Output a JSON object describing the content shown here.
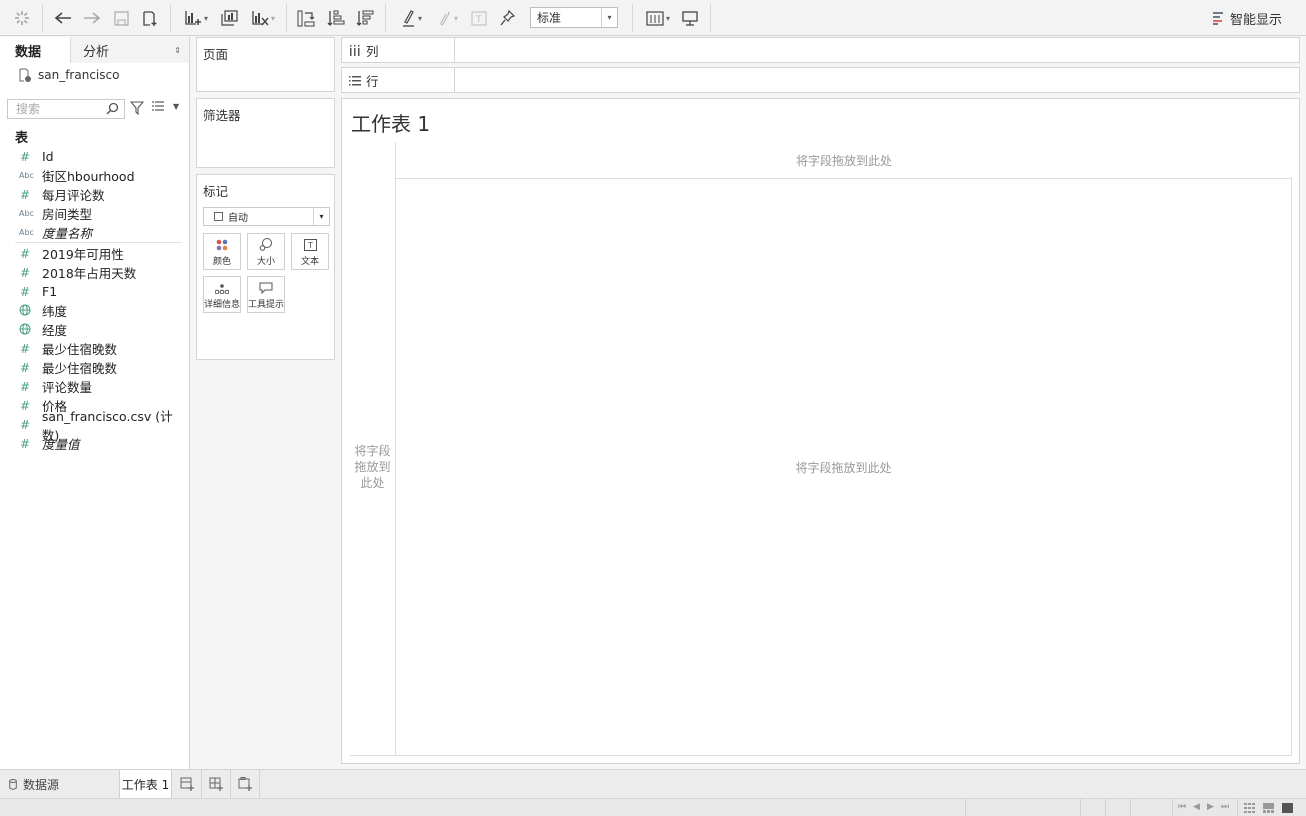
{
  "toolbar": {
    "zoom_select": "标准",
    "smart_show_label": "智能显示",
    "icons": [
      "tableau-logo-icon",
      "undo-icon",
      "redo-icon",
      "save-icon",
      "new-datasource-icon",
      "new-worksheet-icon",
      "duplicate-icon",
      "clear-sheet-icon",
      "swap-icon",
      "sort-ascending-icon",
      "sort-descending-icon",
      "highlight-icon",
      "group-icon",
      "label-icon",
      "pin-icon",
      "show-cards-icon",
      "presentation-icon"
    ]
  },
  "data_pane": {
    "tabs": {
      "data": "数据",
      "analytics": "分析"
    },
    "datasource_name": "san_francisco",
    "search_placeholder": "搜索",
    "tables_heading": "表",
    "fields": [
      {
        "type": "num",
        "label": "Id"
      },
      {
        "type": "abc",
        "label": "街区hbourhood"
      },
      {
        "type": "num",
        "label": "每月评论数"
      },
      {
        "type": "abc",
        "label": "房间类型"
      },
      {
        "type": "abc",
        "label": "度量名称",
        "italic": true
      }
    ],
    "measures": [
      {
        "type": "num",
        "label": "2019年可用性"
      },
      {
        "type": "num",
        "label": "2018年占用天数"
      },
      {
        "type": "num",
        "label": "F1"
      },
      {
        "type": "geo",
        "label": "纬度"
      },
      {
        "type": "geo",
        "label": "经度"
      },
      {
        "type": "num",
        "label": "最少住宿晚数"
      },
      {
        "type": "num",
        "label": "最少住宿晚数"
      },
      {
        "type": "num",
        "label": "评论数量"
      },
      {
        "type": "num",
        "label": "价格"
      },
      {
        "type": "num",
        "label": "san_francisco.csv (计数)"
      },
      {
        "type": "num",
        "label": "度量值",
        "italic": true
      }
    ]
  },
  "cards": {
    "pages": "页面",
    "filters": "筛选器",
    "marks": {
      "title": "标记",
      "mark_type": "自动",
      "buttons": {
        "color": "颜色",
        "size": "大小",
        "text": "文本",
        "detail": "详细信息",
        "tooltip": "工具提示"
      }
    }
  },
  "shelves": {
    "columns": "列",
    "rows": "行"
  },
  "sheet": {
    "title": "工作表 1",
    "drop_top": "将字段拖放到此处",
    "drop_left": "将字段拖放到此处",
    "drop_main": "将字段拖放到此处"
  },
  "tabbar": {
    "datasource": "数据源",
    "sheet": "工作表 1"
  }
}
